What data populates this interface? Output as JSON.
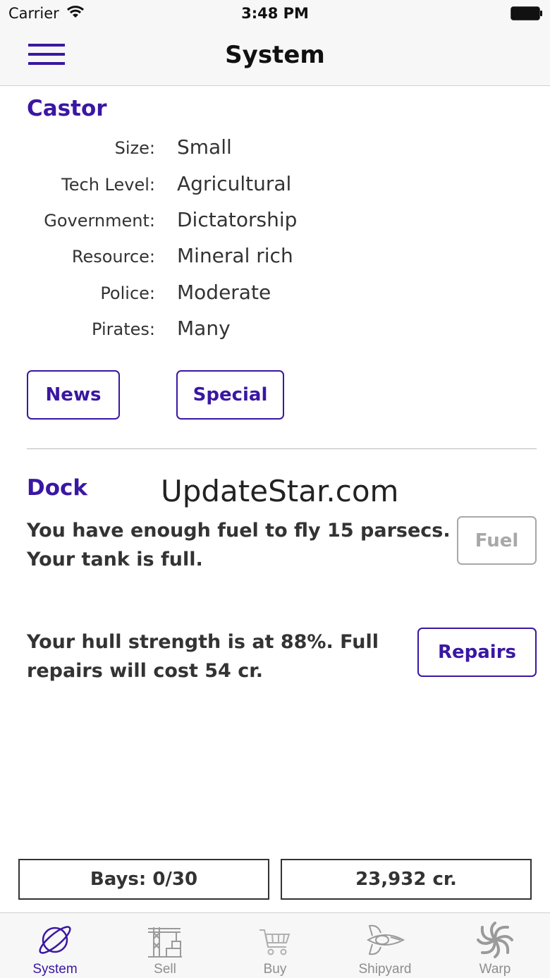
{
  "status_bar": {
    "carrier": "Carrier",
    "time": "3:48 PM"
  },
  "nav": {
    "title": "System"
  },
  "system": {
    "name": "Castor",
    "rows": [
      {
        "label": "Size:",
        "value": "Small"
      },
      {
        "label": "Tech Level:",
        "value": "Agricultural"
      },
      {
        "label": "Government:",
        "value": "Dictatorship"
      },
      {
        "label": "Resource:",
        "value": "Mineral rich"
      },
      {
        "label": "Police:",
        "value": "Moderate"
      },
      {
        "label": "Pirates:",
        "value": "Many"
      }
    ],
    "news_label": "News",
    "special_label": "Special"
  },
  "dock": {
    "title": "Dock",
    "fuel_text_1": "You have enough fuel to fly 15 parsecs.",
    "fuel_text_2": "Your tank is full.",
    "fuel_label": "Fuel",
    "hull_text_1": "Your hull strength is at 88%. Full",
    "hull_text_2": "repairs will cost 54 cr.",
    "repairs_label": "Repairs"
  },
  "watermark": "UpdateStar.com",
  "footer": {
    "bays": "Bays: 0/30",
    "credits": "23,932 cr."
  },
  "tabs": [
    {
      "label": "System",
      "icon": "planet-icon",
      "active": true
    },
    {
      "label": "Sell",
      "icon": "crane-icon",
      "active": false
    },
    {
      "label": "Buy",
      "icon": "cart-icon",
      "active": false
    },
    {
      "label": "Shipyard",
      "icon": "ship-icon",
      "active": false
    },
    {
      "label": "Warp",
      "icon": "spiral-icon",
      "active": false
    }
  ],
  "colors": {
    "accent": "#3a17a3",
    "inactive": "#8e8e8e",
    "disabled": "#a8a8a8",
    "text": "#333333"
  }
}
